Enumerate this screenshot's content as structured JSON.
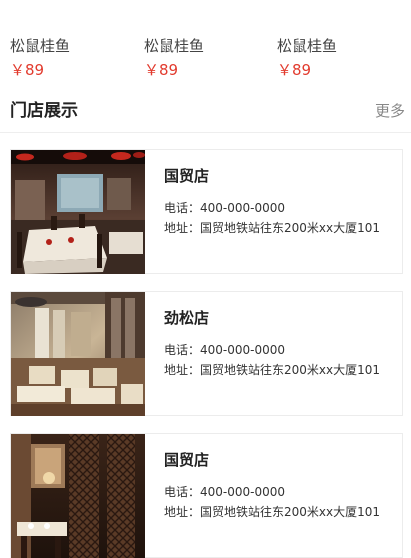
{
  "dishes": [
    {
      "name": "松鼠桂鱼",
      "price": "￥89"
    },
    {
      "name": "松鼠桂鱼",
      "price": "￥89"
    },
    {
      "name": "松鼠桂鱼",
      "price": "￥89"
    }
  ],
  "stores_section": {
    "title": "门店展示",
    "more_label": "更多"
  },
  "stores": [
    {
      "name": "国贸店",
      "phone": "电话：400-000-0000",
      "address": "地址：国贸地铁站往东200米xx大厦101",
      "image": "restaurant-interior-red-lanterns-photo"
    },
    {
      "name": "劲松店",
      "phone": "电话：400-000-0000",
      "address": "地址：国贸地铁站往东200米xx大厦101",
      "image": "restaurant-interior-bright-dining-photo"
    },
    {
      "name": "国贸店",
      "phone": "电话：400-000-0000",
      "address": "地址：国贸地铁站往东200米xx大厦101",
      "image": "restaurant-interior-wood-lattice-photo"
    }
  ],
  "colors": {
    "price": "#e23b2e",
    "title": "#222222",
    "muted": "#888888",
    "border": "#ececec"
  }
}
